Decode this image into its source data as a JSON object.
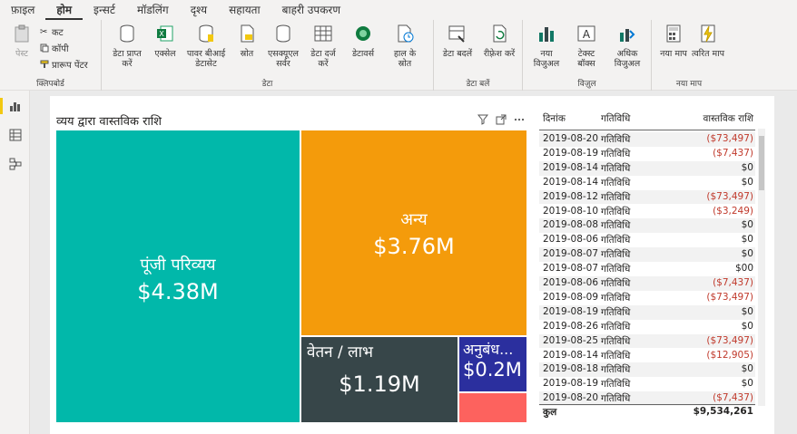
{
  "menu": {
    "tabs": [
      {
        "label": "फ़ाइल",
        "active": false
      },
      {
        "label": "होम",
        "active": true
      },
      {
        "label": "इन्सर्ट",
        "active": false
      },
      {
        "label": "मॉडलिंग",
        "active": false
      },
      {
        "label": "दृश्य",
        "active": false
      },
      {
        "label": "सहायता",
        "active": false
      },
      {
        "label": "बाहरी उपकरण",
        "active": false
      }
    ]
  },
  "ribbon": {
    "clipboard": {
      "paste": "पेस्ट",
      "cut": "कट",
      "copy": "कॉपी",
      "format_painter": "प्रारूप पेंटर",
      "group_label": "क्लिपबोर्ड"
    },
    "data": {
      "get_data": "डेटा प्राप्त करें",
      "excel": "एक्सेल",
      "pbi_dataset": "पावर बीआई डेटासेट",
      "sql_server": "एसक्यूएल सर्वर",
      "source": "स्रोत",
      "enter_data": "डेटा दर्ज करें",
      "dataverse": "डेटावर्स",
      "recent_sources": "हाल के स्रोत",
      "group_label": "डेटा"
    },
    "queries": {
      "transform": "डेटा बदलें",
      "refresh": "रीफ़्रेश करें",
      "group_label": "डेटा बलें"
    },
    "visuals": {
      "new_visual": "नया विजुअल",
      "text_box": "टेक्स्ट बॉक्स",
      "more_visuals": "अधिक विजुअल",
      "group_label": "विज़ुल"
    },
    "measures": {
      "new_measure": "नया माप",
      "quick_measure": "त्वरित माप",
      "group_label": "नया माप"
    }
  },
  "treemap": {
    "title": "व्यय द्वारा वास्तविक राशि",
    "tiles": [
      {
        "label": "पूंजी परिव्यय",
        "value": "$4.38M",
        "color": "#01b8aa"
      },
      {
        "label": "अन्य",
        "value": "$3.76M",
        "color": "#f49b0b"
      },
      {
        "label": "वेतन / लाभ",
        "value": "$1.19M",
        "color": "#374649"
      },
      {
        "label": "अनुबंध...",
        "value": "$0.2M",
        "color": "#2b2f9e"
      },
      {
        "label": "",
        "value": "",
        "color": "#fd625e"
      }
    ]
  },
  "table": {
    "headers": {
      "date": "दिनांक",
      "activity": "गतिविधि",
      "amount": "वास्तविक राशि"
    },
    "rows": [
      {
        "date": "2019-08-20",
        "activity": "गतिविधि",
        "amount": "($73,497)",
        "negative": true
      },
      {
        "date": "2019-08-19",
        "activity": "गतिविधि",
        "amount": "($7,437)",
        "negative": true
      },
      {
        "date": "2019-08-14",
        "activity": "गतिविधि",
        "amount": "$0",
        "negative": false
      },
      {
        "date": "2019-08-14",
        "activity": "गतिविधि",
        "amount": "$0",
        "negative": false
      },
      {
        "date": "2019-08-12",
        "activity": "गतिविधि",
        "amount": "($73,497)",
        "negative": true
      },
      {
        "date": "2019-08-10",
        "activity": "गतिविधि",
        "amount": "($3,249)",
        "negative": true
      },
      {
        "date": "2019-08-08",
        "activity": "गतिविधि",
        "amount": "$0",
        "negative": false
      },
      {
        "date": "2019-08-06",
        "activity": "गतिविधि",
        "amount": "$0",
        "negative": false
      },
      {
        "date": "2019-08-07",
        "activity": "गतिविधि",
        "amount": "$0",
        "negative": false
      },
      {
        "date": "2019-08-07",
        "activity": "गतिविधि",
        "amount": "$00",
        "negative": false
      },
      {
        "date": "2019-08-06",
        "activity": "गतिविधि",
        "amount": "($7,437)",
        "negative": true
      },
      {
        "date": "2019-08-09",
        "activity": "गतिविधि",
        "amount": "($73,497)",
        "negative": true
      },
      {
        "date": "2019-08-19",
        "activity": "गतिविधि",
        "amount": "$0",
        "negative": false
      },
      {
        "date": "2019-08-26",
        "activity": "गतिविधि",
        "amount": "$0",
        "negative": false
      },
      {
        "date": "2019-08-25",
        "activity": "गतिविधि",
        "amount": "($73,497)",
        "negative": true
      },
      {
        "date": "2019-08-14",
        "activity": "गतिविधि",
        "amount": "($12,905)",
        "negative": true
      },
      {
        "date": "2019-08-18",
        "activity": "गतिविधि",
        "amount": "$0",
        "negative": false
      },
      {
        "date": "2019-08-19",
        "activity": "गतिविधि",
        "amount": "$0",
        "negative": false
      },
      {
        "date": "2019-08-20",
        "activity": "गतिविधि",
        "amount": "($7,437)",
        "negative": true
      }
    ],
    "total_label": "कुल",
    "total_value": "$9,534,261"
  }
}
